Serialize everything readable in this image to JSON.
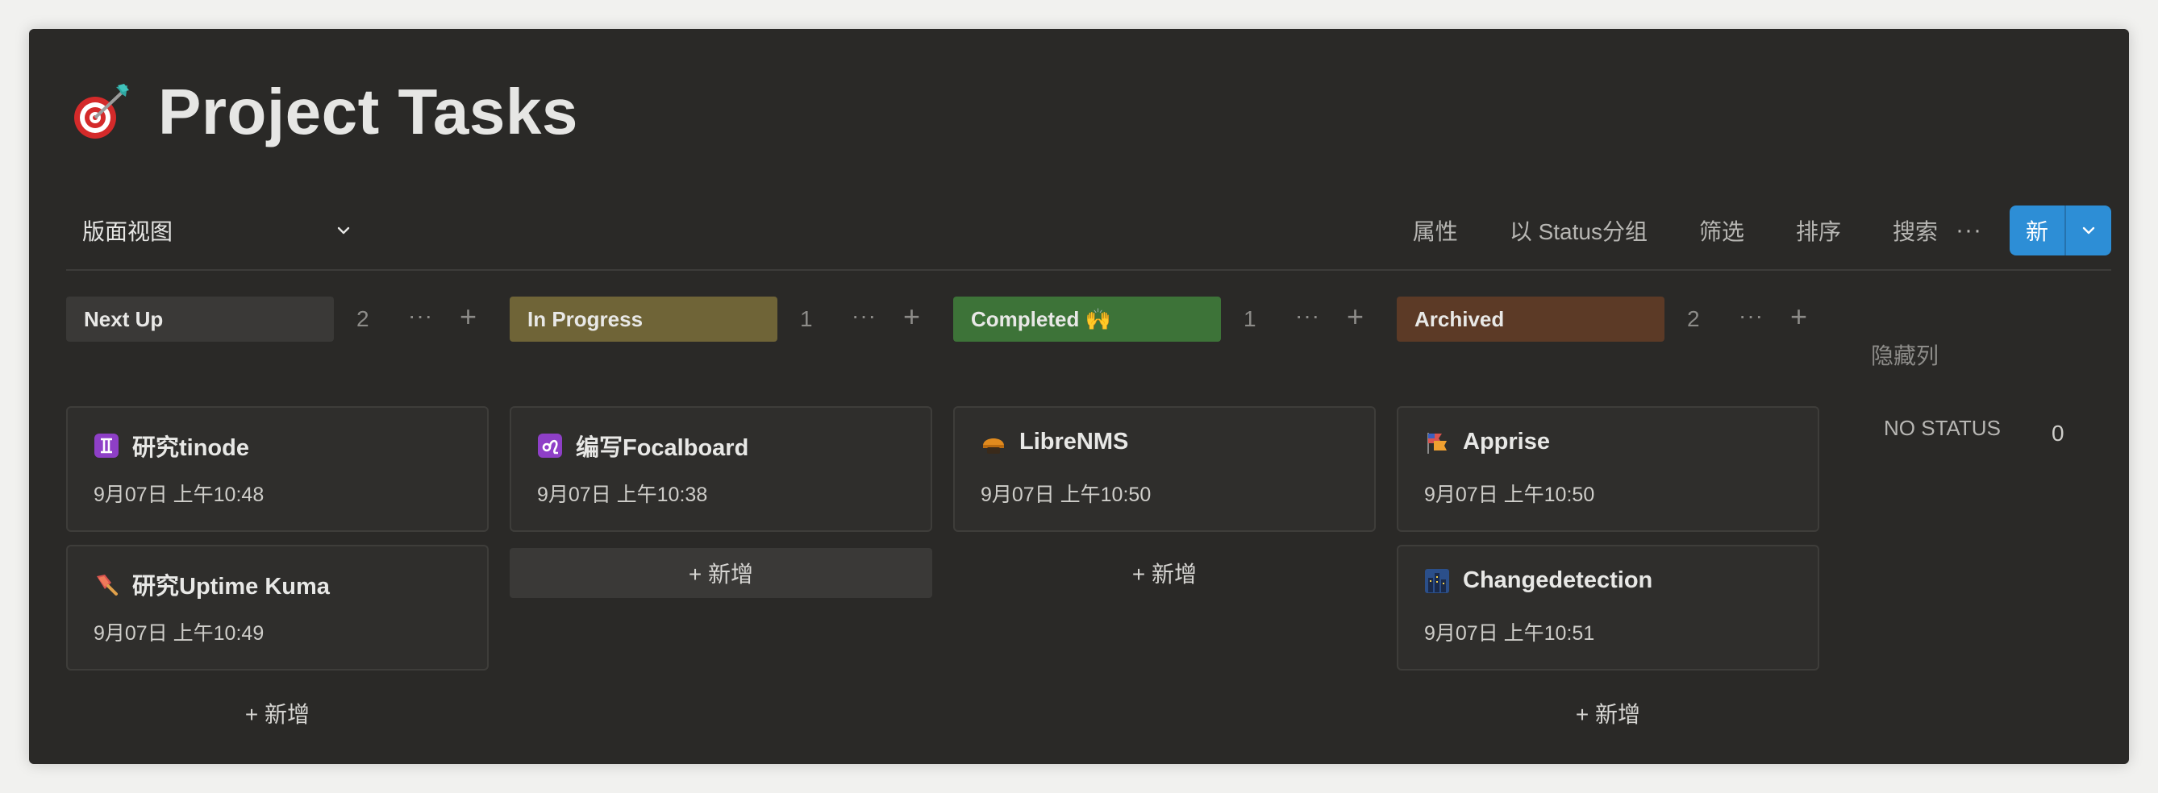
{
  "page": {
    "title": "Project Tasks",
    "title_icon": "dart-target-icon"
  },
  "toolbar": {
    "view_label": "版面视图",
    "properties": "属性",
    "group_by": "以 Status分组",
    "filter": "筛选",
    "sort": "排序",
    "search": "搜索",
    "more": "···",
    "new_label": "新"
  },
  "columns": [
    {
      "label": "Next Up",
      "color": "#3a3937",
      "count": "2",
      "dots": "···",
      "plus": "+",
      "cards": [
        {
          "icon": "gemini-sign-icon",
          "title": "研究tinode",
          "date": "9月07日 上午10:48"
        },
        {
          "icon": "shovel-icon",
          "title": "研究Uptime Kuma",
          "date": "9月07日 上午10:49"
        }
      ],
      "add_label": "+ 新增"
    },
    {
      "label": "In Progress",
      "color": "#6f6437",
      "count": "1",
      "dots": "···",
      "plus": "+",
      "cards": [
        {
          "icon": "leo-sign-icon",
          "title": "编写Focalboard",
          "date": "9月07日 上午10:38"
        }
      ],
      "add_label": "+ 新增"
    },
    {
      "label": "Completed 🙌",
      "color": "#3d7338",
      "count": "1",
      "dots": "···",
      "plus": "+",
      "cards": [
        {
          "icon": "helmet-icon",
          "title": "LibreNMS",
          "date": "9月07日 上午10:50"
        }
      ],
      "add_label": "+ 新增"
    },
    {
      "label": "Archived",
      "color": "#5c3a26",
      "count": "2",
      "dots": "···",
      "plus": "+",
      "cards": [
        {
          "icon": "flags-icon",
          "title": "Apprise",
          "date": "9月07日 上午10:50"
        },
        {
          "icon": "city-night-icon",
          "title": "Changedetection",
          "date": "9月07日 上午10:51"
        }
      ],
      "add_label": "+ 新增"
    }
  ],
  "hidden_columns_label": "隐藏列",
  "no_status": {
    "label": "NO STATUS",
    "count": "0"
  }
}
